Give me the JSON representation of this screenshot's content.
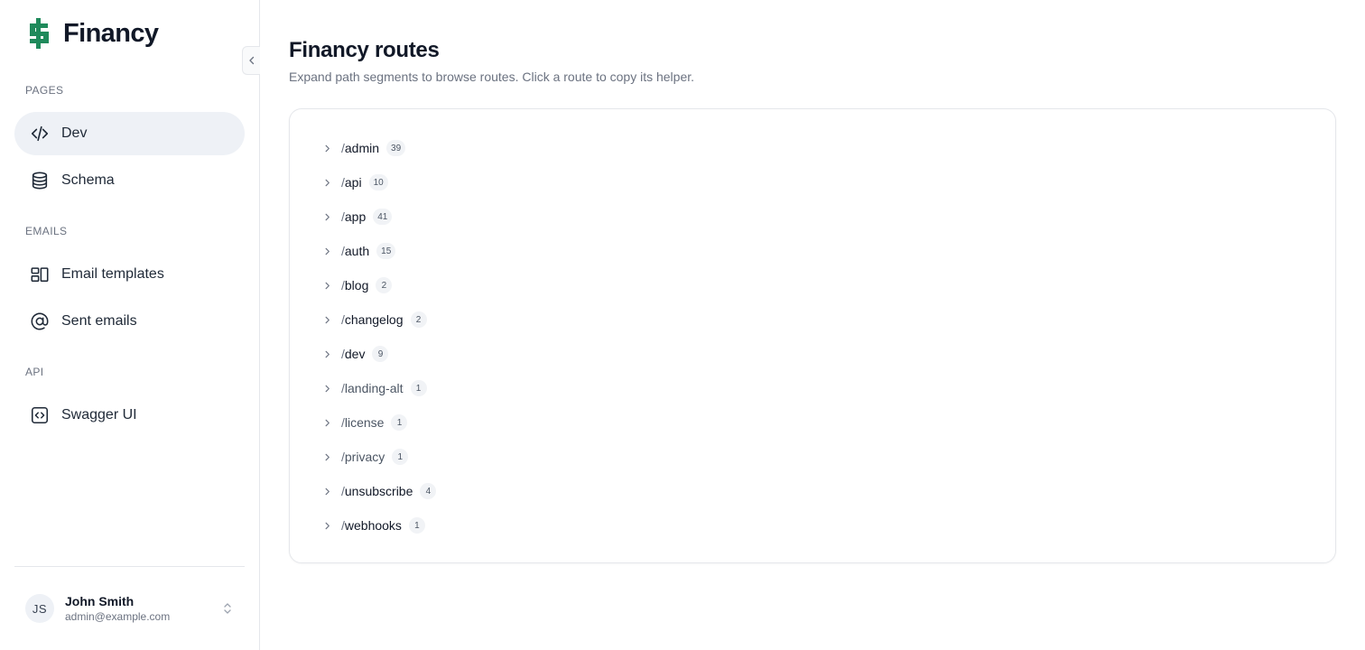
{
  "brand": {
    "name": "Financy",
    "accent": "#1f8a5b"
  },
  "sidebar": {
    "sections": [
      {
        "label": "PAGES"
      },
      {
        "label": "EMAILS"
      },
      {
        "label": "API"
      }
    ],
    "items": [
      {
        "label": "Dev",
        "icon": "code-icon",
        "active": true
      },
      {
        "label": "Schema",
        "icon": "database-icon",
        "active": false
      },
      {
        "label": "Email templates",
        "icon": "templates-icon",
        "active": false
      },
      {
        "label": "Sent emails",
        "icon": "at-sign-icon",
        "active": false
      },
      {
        "label": "Swagger UI",
        "icon": "code-square-icon",
        "active": false
      }
    ],
    "user": {
      "initials": "JS",
      "name": "John Smith",
      "email": "admin@example.com"
    }
  },
  "main": {
    "title": "Financy routes",
    "subtitle": "Expand path segments to browse routes. Click a route to copy its helper.",
    "routes": [
      {
        "slash": "/",
        "segment": "admin",
        "count": "39"
      },
      {
        "slash": "/",
        "segment": "api",
        "count": "10"
      },
      {
        "slash": "/",
        "segment": "app",
        "count": "41"
      },
      {
        "slash": "/",
        "segment": "auth",
        "count": "15"
      },
      {
        "slash": "/",
        "segment": "blog",
        "count": "2"
      },
      {
        "slash": "/",
        "segment": "changelog",
        "count": "2"
      },
      {
        "slash": "/",
        "segment": "dev",
        "count": "9"
      },
      {
        "slash": "/",
        "segment": "landing-alt",
        "count": "1"
      },
      {
        "slash": "/",
        "segment": "license",
        "count": "1"
      },
      {
        "slash": "/",
        "segment": "privacy",
        "count": "1"
      },
      {
        "slash": "/",
        "segment": "unsubscribe",
        "count": "4"
      },
      {
        "slash": "/",
        "segment": "webhooks",
        "count": "1"
      }
    ]
  }
}
